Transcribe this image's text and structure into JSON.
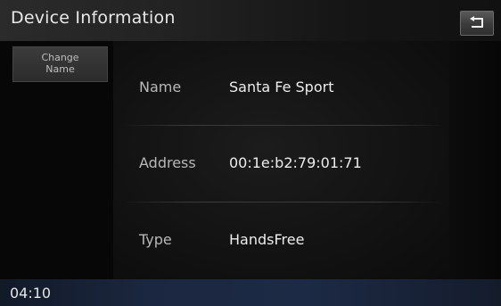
{
  "header": {
    "title": "Device Information",
    "back_icon": "back-arrow-icon"
  },
  "sidebar": {
    "change_name_line1": "Change",
    "change_name_line2": "Name"
  },
  "device": {
    "name_label": "Name",
    "name_value": "Santa Fe Sport",
    "address_label": "Address",
    "address_value": "00:1e:b2:79:01:71",
    "type_label": "Type",
    "type_value": "HandsFree"
  },
  "status_bar": {
    "time": "04:10"
  },
  "colors": {
    "title_text": "#e8e8e8",
    "label_text": "#b8b8b8",
    "value_text": "#ededed",
    "status_bar_bg": "#1b2740"
  }
}
